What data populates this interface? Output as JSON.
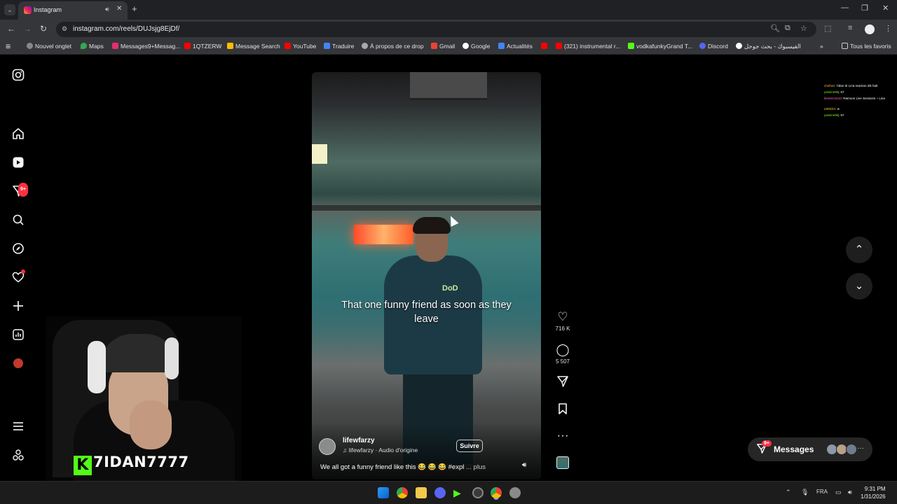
{
  "browser": {
    "tab_title": "Instagram",
    "url": "instagram.com/reels/DUJsjg8EjDf/",
    "bookmarks": [
      "Nouvel onglet",
      "Maps",
      "Messages9+Messag...",
      "1QTZERW",
      "Message Search",
      "YouTube",
      "Traduire",
      "À propos de ce drop",
      "Gmail",
      "Google",
      "Actualités",
      "(321) instrumental r...",
      "vodkafunkyGrand T...",
      "Discord",
      "الفيسبوك - بحث جوجل"
    ],
    "all_bookmarks": "Tous les favoris"
  },
  "sidebar": {
    "notifications_badge": "9+",
    "items": [
      "instagram-logo",
      "home",
      "reels",
      "messages",
      "search",
      "explore",
      "notifications",
      "create",
      "dashboard",
      "profile",
      "more",
      "also-from-meta"
    ]
  },
  "reel": {
    "caption_overlay": "That one funny friend as soon as they leave",
    "username": "lifewfarzy",
    "audio": "lifewfarzy · Audio d'origine",
    "follow_label": "Suivre",
    "description": "We all got a funny friend like this 😂 😂 😂 #expl",
    "more_label": "... plus",
    "shirt_logo": "DoD"
  },
  "actions": {
    "likes": "716 K",
    "comments": "5 507"
  },
  "messages": {
    "label": "Messages",
    "badge": "9+",
    "more": "···"
  },
  "chat_overlay": [
    {
      "user": "chefnet",
      "text": ": 7idan dr Lina reaction 2tk hab",
      "color": "#ffb347"
    },
    {
      "user": "yassine9kj",
      "text": ": 67",
      "color": "#7cfc00"
    },
    {
      "user": "ibrahim1510",
      "text": ": Ramoon Live Sessions ~ Lina",
      "color": "#ff69b4"
    },
    {
      "user": "LWIZZA",
      "text": ": w",
      "color": "#ffd700"
    },
    {
      "user": "yassine9kj",
      "text": ": 67",
      "color": "#7cfc00"
    }
  ],
  "streamer": {
    "name": "7IDAN7777",
    "logo_letter": "K"
  },
  "taskbar": {
    "language": "FRA",
    "time": "9:31 PM",
    "date": "1/31/2026"
  }
}
